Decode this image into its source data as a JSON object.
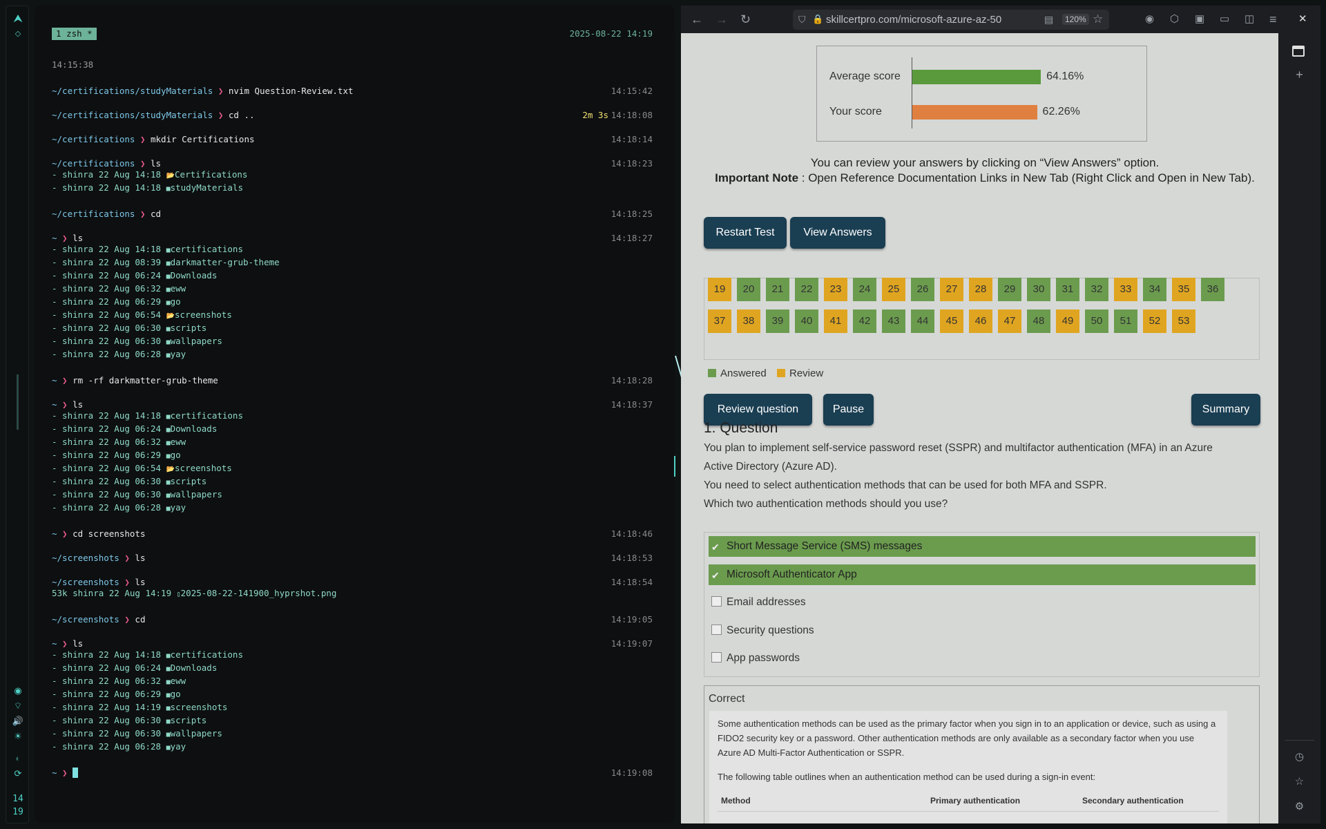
{
  "sidebar": {
    "clock_h": "14",
    "clock_m": "19"
  },
  "terminal": {
    "tab_label": "1 zsh *",
    "tab_date": "2025-08-22 14:19",
    "first_time": "14:15:38",
    "lines": [
      {
        "type": "cmd",
        "dir": "~/certifications/studyMaterials",
        "cmd": "nvim Question-Review.txt",
        "time": "14:15:42"
      },
      {
        "type": "cmd",
        "dir": "~/certifications/studyMaterials",
        "cmd": "cd ..",
        "dur": "2m 3s",
        "time": "14:18:08"
      },
      {
        "type": "cmd",
        "dir": "~/certifications",
        "cmd": "mkdir Certifications",
        "time": "14:18:14"
      },
      {
        "type": "cmd",
        "dir": "~/certifications",
        "cmd": "ls",
        "time": "14:18:23"
      },
      {
        "type": "ls",
        "text": "- shinra 22 Aug 14:18 ",
        "name": "Certifications",
        "icon": "📂"
      },
      {
        "type": "ls",
        "text": "- shinra 22 Aug 14:18 ",
        "name": "studyMaterials",
        "icon": "■"
      },
      {
        "type": "cmd",
        "dir": "~/certifications",
        "cmd": "cd",
        "time": "14:18:25"
      },
      {
        "type": "cmd",
        "dir": "~",
        "cmd": "ls",
        "time": "14:18:27"
      },
      {
        "type": "ls",
        "text": "- shinra 22 Aug 14:18 ",
        "name": "certifications",
        "icon": "■"
      },
      {
        "type": "ls",
        "text": "- shinra 22 Aug 08:39 ",
        "name": "darkmatter-grub-theme",
        "icon": "■"
      },
      {
        "type": "ls",
        "text": "- shinra 22 Aug 06:24 ",
        "name": "Downloads",
        "icon": "■"
      },
      {
        "type": "ls",
        "text": "- shinra 22 Aug 06:32 ",
        "name": "eww",
        "icon": "■"
      },
      {
        "type": "ls",
        "text": "- shinra 22 Aug 06:29 ",
        "name": "go",
        "icon": "■"
      },
      {
        "type": "ls",
        "text": "- shinra 22 Aug 06:54 ",
        "name": "screenshots",
        "icon": "📂"
      },
      {
        "type": "ls",
        "text": "- shinra 22 Aug 06:30 ",
        "name": "scripts",
        "icon": "■"
      },
      {
        "type": "ls",
        "text": "- shinra 22 Aug 06:30 ",
        "name": "wallpapers",
        "icon": "■"
      },
      {
        "type": "ls",
        "text": "- shinra 22 Aug 06:28 ",
        "name": "yay",
        "icon": "■"
      },
      {
        "type": "cmd",
        "dir": "~",
        "cmd": "rm -rf darkmatter-grub-theme",
        "time": "14:18:28"
      },
      {
        "type": "cmd",
        "dir": "~",
        "cmd": "ls",
        "time": "14:18:37"
      },
      {
        "type": "ls",
        "text": "- shinra 22 Aug 14:18 ",
        "name": "certifications",
        "icon": "■"
      },
      {
        "type": "ls",
        "text": "- shinra 22 Aug 06:24 ",
        "name": "Downloads",
        "icon": "■"
      },
      {
        "type": "ls",
        "text": "- shinra 22 Aug 06:32 ",
        "name": "eww",
        "icon": "■"
      },
      {
        "type": "ls",
        "text": "- shinra 22 Aug 06:29 ",
        "name": "go",
        "icon": "■"
      },
      {
        "type": "ls",
        "text": "- shinra 22 Aug 06:54 ",
        "name": "screenshots",
        "icon": "📂"
      },
      {
        "type": "ls",
        "text": "- shinra 22 Aug 06:30 ",
        "name": "scripts",
        "icon": "■"
      },
      {
        "type": "ls",
        "text": "- shinra 22 Aug 06:30 ",
        "name": "wallpapers",
        "icon": "■"
      },
      {
        "type": "ls",
        "text": "- shinra 22 Aug 06:28 ",
        "name": "yay",
        "icon": "■"
      },
      {
        "type": "cmd",
        "dir": "~",
        "cmd": "cd screenshots",
        "time": "14:18:46"
      },
      {
        "type": "cmd",
        "dir": "~/screenshots",
        "cmd": "ls",
        "time": "14:18:53"
      },
      {
        "type": "cmd",
        "dir": "~/screenshots",
        "cmd": "ls",
        "time": "14:18:54"
      },
      {
        "type": "ls",
        "text": "53k shinra 22 Aug 14:19 ",
        "name": "2025-08-22-141900_hyprshot.png",
        "icon": "▯"
      },
      {
        "type": "cmd",
        "dir": "~/screenshots",
        "cmd": "cd",
        "time": "14:19:05"
      },
      {
        "type": "cmd",
        "dir": "~",
        "cmd": "ls",
        "time": "14:19:07"
      },
      {
        "type": "ls",
        "text": "- shinra 22 Aug 14:18 ",
        "name": "certifications",
        "icon": "■"
      },
      {
        "type": "ls",
        "text": "- shinra 22 Aug 06:24 ",
        "name": "Downloads",
        "icon": "■"
      },
      {
        "type": "ls",
        "text": "- shinra 22 Aug 06:32 ",
        "name": "eww",
        "icon": "■"
      },
      {
        "type": "ls",
        "text": "- shinra 22 Aug 06:29 ",
        "name": "go",
        "icon": "■"
      },
      {
        "type": "ls",
        "text": "- shinra 22 Aug 14:19 ",
        "name": "screenshots",
        "icon": "■"
      },
      {
        "type": "ls",
        "text": "- shinra 22 Aug 06:30 ",
        "name": "scripts",
        "icon": "■"
      },
      {
        "type": "ls",
        "text": "- shinra 22 Aug 06:30 ",
        "name": "wallpapers",
        "icon": "■"
      },
      {
        "type": "ls",
        "text": "- shinra 22 Aug 06:28 ",
        "name": "yay",
        "icon": "■"
      },
      {
        "type": "prompt",
        "dir": "~",
        "time": "14:19:08"
      }
    ]
  },
  "browser": {
    "url": "skillcertpro.com/microsoft-azure-az-50",
    "zoom": "120%"
  },
  "quiz": {
    "scores": [
      {
        "label": "Average score",
        "value": "64.16%",
        "pct": 64.16,
        "color": "#5a9a3c"
      },
      {
        "label": "Your score",
        "value": "62.26%",
        "pct": 62.26,
        "color": "#e08040"
      }
    ],
    "review_text": "You can review your answers by clicking on “View Answers” option.",
    "note_bold": "Important Note",
    "note_text": " : Open Reference Documentation Links in New Tab (Right Click and Open in New Tab).",
    "restart_label": "Restart Test",
    "view_answers_label": "View Answers",
    "grid": [
      {
        "n": "19",
        "s": "review"
      },
      {
        "n": "20",
        "s": "answered"
      },
      {
        "n": "21",
        "s": "answered"
      },
      {
        "n": "22",
        "s": "answered"
      },
      {
        "n": "23",
        "s": "review"
      },
      {
        "n": "24",
        "s": "answered"
      },
      {
        "n": "25",
        "s": "review"
      },
      {
        "n": "26",
        "s": "answered"
      },
      {
        "n": "27",
        "s": "review"
      },
      {
        "n": "28",
        "s": "review"
      },
      {
        "n": "29",
        "s": "answered"
      },
      {
        "n": "30",
        "s": "answered"
      },
      {
        "n": "31",
        "s": "answered"
      },
      {
        "n": "32",
        "s": "answered"
      },
      {
        "n": "33",
        "s": "review"
      },
      {
        "n": "34",
        "s": "answered"
      },
      {
        "n": "35",
        "s": "review"
      },
      {
        "n": "36",
        "s": "answered"
      },
      {
        "n": "37",
        "s": "review"
      },
      {
        "n": "38",
        "s": "review"
      },
      {
        "n": "39",
        "s": "answered"
      },
      {
        "n": "40",
        "s": "answered"
      },
      {
        "n": "41",
        "s": "review"
      },
      {
        "n": "42",
        "s": "answered"
      },
      {
        "n": "43",
        "s": "answered"
      },
      {
        "n": "44",
        "s": "answered"
      },
      {
        "n": "45",
        "s": "review"
      },
      {
        "n": "46",
        "s": "review"
      },
      {
        "n": "47",
        "s": "review"
      },
      {
        "n": "48",
        "s": "answered"
      },
      {
        "n": "49",
        "s": "review"
      },
      {
        "n": "50",
        "s": "answered"
      },
      {
        "n": "51",
        "s": "answered"
      },
      {
        "n": "52",
        "s": "review"
      },
      {
        "n": "53",
        "s": "review"
      }
    ],
    "colors": {
      "answered": "#6b9c4e",
      "review": "#e0a520"
    },
    "legend_answered": "Answered",
    "legend_review": "Review",
    "review_question_label": "Review question",
    "pause_label": "Pause",
    "summary_label": "Summary",
    "question_title": "1. Question",
    "question_lines": [
      "You plan to implement self-service password reset (SSPR) and multifactor authentication (MFA) in an Azure",
      "Active Directory (Azure AD).",
      "You need to select authentication methods that can be used for both MFA and SSPR.",
      "Which two authentication methods should you use?"
    ],
    "options": [
      {
        "label": "Short Message Service (SMS) messages",
        "selected": true
      },
      {
        "label": "Microsoft Authenticator App",
        "selected": true
      },
      {
        "label": "Email addresses",
        "selected": false
      },
      {
        "label": "Security questions",
        "selected": false
      },
      {
        "label": "App passwords",
        "selected": false
      }
    ],
    "correct_title": "Correct",
    "explanation_p1": "Some authentication methods can be used as the primary factor when you sign in to an application or device, such as using a FIDO2 security key or a password. Other authentication methods are only available as a secondary factor when you use Azure AD Multi-Factor Authentication or SSPR.",
    "explanation_p2": "The following table outlines when an authentication method can be used during a sign-in event:",
    "table_headers": [
      "Method",
      "Primary authentication",
      "Secondary authentication"
    ]
  }
}
